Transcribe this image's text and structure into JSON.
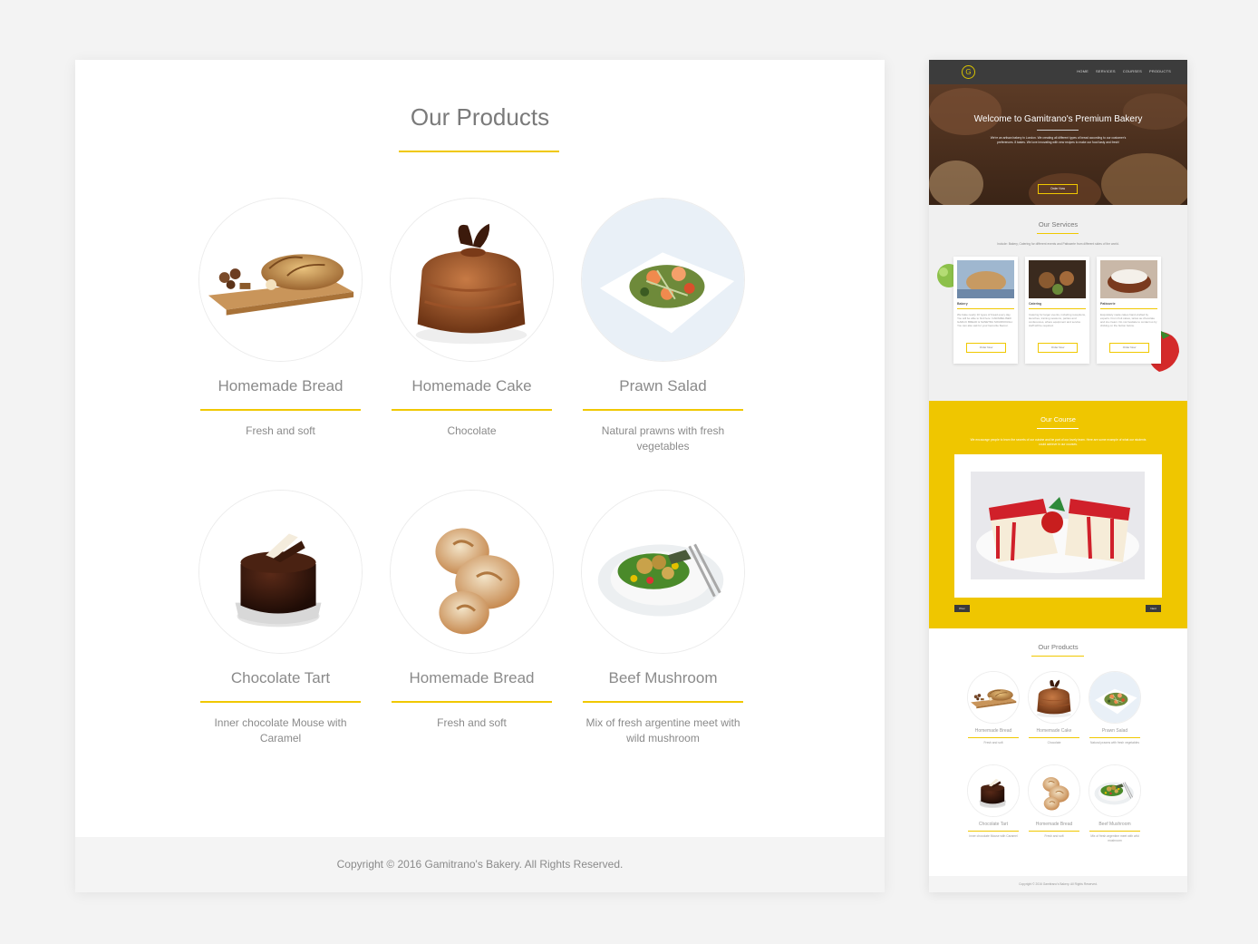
{
  "products_section": {
    "title": "Our Products",
    "items": [
      {
        "name": "Homemade Bread",
        "desc": "Fresh and soft",
        "icon": "bread-loaf-icon"
      },
      {
        "name": "Homemade Cake",
        "desc": "Chocolate",
        "icon": "chocolate-cake-icon"
      },
      {
        "name": "Prawn Salad",
        "desc": "Natural prawns with fresh vegetables",
        "icon": "prawn-salad-icon"
      },
      {
        "name": "Chocolate Tart",
        "desc": "Inner chocolate Mouse with Caramel",
        "icon": "chocolate-tart-icon"
      },
      {
        "name": "Homemade Bread",
        "desc": "Fresh and soft",
        "icon": "bread-rolls-icon"
      },
      {
        "name": "Beef Mushroom",
        "desc": "Mix of fresh argentine meet with wild mushroom",
        "icon": "beef-mushroom-plate-icon"
      }
    ]
  },
  "footer": {
    "copyright": "Copyright © 2016 Gamitrano's Bakery. All Rights Reserved."
  },
  "mini": {
    "logo": "G",
    "nav": [
      "HOME",
      "SERVICES",
      "COURSES",
      "PRODUCTS"
    ],
    "hero": {
      "title": "Welcome to Gamitrano's Premium Bakery",
      "subtitle": "We're an artisan bakery in London. We creating all different types of bread according to our customer's preferences. 8 tastes. We love innovating with new recipes to make our food tasty and fresh!",
      "button": "Order Now"
    },
    "services": {
      "title": "Our Services",
      "subtitle": "Include: Bakery, Catering for different events and Patisserie from different sides of the world.",
      "cards": [
        {
          "title": "Bakery",
          "desc": "We bake nearly 10 types of bread every day. You will be able to find here: CARAMELISED GARLIC BREAD & SANETRA SOURDOUGH. You can also ask for your favourite flavour.",
          "button": "Order Now"
        },
        {
          "title": "Catering",
          "desc": "Catering for larger events, including receptions, launches, training sessions, parties and conferences, where equipment and service staff will be required.",
          "button": "Order Now"
        },
        {
          "title": "Patisserie",
          "desc": "Exquisitely made cakes hand-crafted by experts. From fruit cakes, tartes au chocolate and ice cream. Do not hesitate to contact us by clicking on the button below.",
          "button": "Order Now"
        }
      ]
    },
    "course": {
      "title": "Our Course",
      "subtitle": "We encourage people to learn the secrets of our cuisine and be part of our lovely team. Here are some example of what our students could achieve in our courses.",
      "prev": "Prev",
      "next": "Next"
    },
    "products": {
      "title": "Our Products",
      "items": [
        {
          "name": "Homemade Bread",
          "desc": "Fresh and soft"
        },
        {
          "name": "Homemade Cake",
          "desc": "Chocolate"
        },
        {
          "name": "Prawn Salad",
          "desc": "Natural prawns with fresh vegetables"
        },
        {
          "name": "Chocolate Tart",
          "desc": "Inner chocolate Mouse with Caramel"
        },
        {
          "name": "Homemade Bread",
          "desc": "Fresh and soft"
        },
        {
          "name": "Beef Mushroom",
          "desc": "Mix of fresh argentine meet with wild mushroom"
        }
      ]
    },
    "footer": "Copyright © 2016 Gamitrano's Bakery. All Rights Reserved."
  },
  "colors": {
    "accent": "#f0c800",
    "background": "#f3f3f3",
    "text": "#888888",
    "nav": "#3c3c3c"
  }
}
